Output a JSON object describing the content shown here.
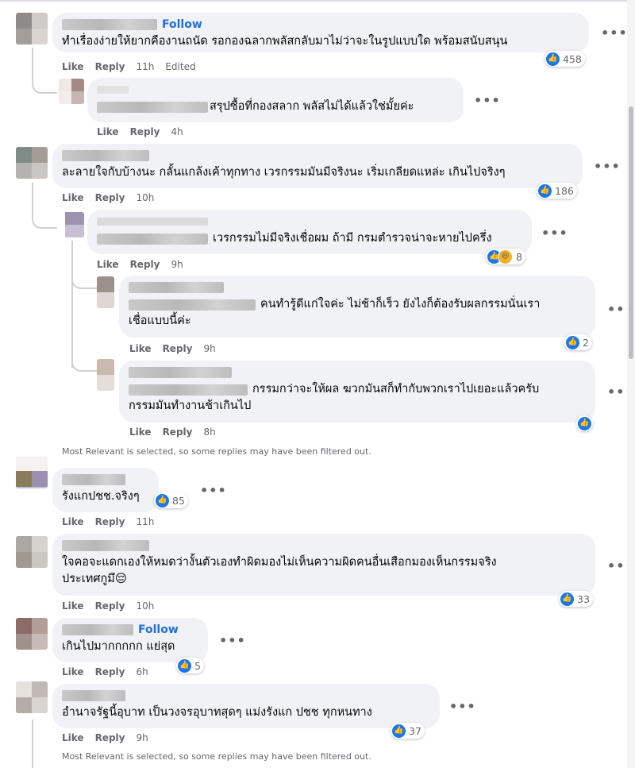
{
  "comments": [
    {
      "author_follow": "Follow",
      "text": "ทำเรื่องง่ายให้ยากคืองานถนัด รอกองฉลากพลัสกลับมาไม่ว่าจะในรูปแบบใด พร้อมสนับสนุน",
      "like": "Like",
      "reply": "Reply",
      "time": "11h",
      "edited": "Edited",
      "count": "458"
    },
    {
      "text": "สรุปซื้อที่กองสลาก พลัสไม่ได้แล้วใช่มั้ยค่ะ",
      "like": "Like",
      "reply": "Reply",
      "time": "4h"
    },
    {
      "text": "ละลายใจกับบ้างนะ กลั้นแกล้งเค้าทุกทาง เวรกรรมมันมีจริงนะ เริ่มเกลียดแหล่ะ เกินไปจริงๆ",
      "like": "Like",
      "reply": "Reply",
      "time": "10h",
      "count": "186"
    },
    {
      "text": "เวรกรรมไม่มีจริงเชื่อผม ถ้ามี กรมตำรวจน่าจะหายไปครึ่ง",
      "like": "Like",
      "reply": "Reply",
      "time": "9h",
      "count": "8"
    },
    {
      "line1": "คนทำรู้ดีแก่ใจค่ะ ไม่ช้าก็เร็ว ยังไงก็ต้องรับผลกรรมนั่นเรา",
      "line2": "เชื่อแบบนี้ค่ะ",
      "like": "Like",
      "reply": "Reply",
      "time": "9h",
      "count": "2"
    },
    {
      "line1": "กรรมกว่าจะให้ผล ฆวกมันสก็ทำกับพวกเราไปเยอะแล้วครับ",
      "line2": "กรรมมันทำงานช้าเกินไป",
      "like": "Like",
      "reply": "Reply",
      "time": "8h"
    },
    {
      "text": "รังแกปชช.จริงๆ",
      "like": "Like",
      "reply": "Reply",
      "time": "11h",
      "count": "85"
    },
    {
      "line1": "ใจคอจะแดกเองให้หมดว่างั้นตัวเองทำผิดมองไม่เห็นความผิดคนอื่นเสือกมองเห็นกรรมจริง",
      "line2": "ประเทศกูมึ😔",
      "like": "Like",
      "reply": "Reply",
      "time": "10h",
      "count": "33"
    },
    {
      "author_follow": "Follow",
      "text": "เกินไปมากกกกก แย่สุด",
      "like": "Like",
      "reply": "Reply",
      "time": "6h",
      "count": "5"
    },
    {
      "text": "อำนาจรัฐนี้อุบาท เป็นวงจรอุบาทสุดๆ แม่งรังแก ปชช ทุกหนทาง",
      "like": "Like",
      "reply": "Reply",
      "time": "9h",
      "count": "37"
    }
  ],
  "filter_note": "Most Relevant is selected, so some replies may have been filtered out.",
  "more": "•••",
  "colors": {
    "like_blue": "#1877f2",
    "follow_blue": "#216fdb",
    "bubble": "#f0f2f5",
    "meta": "#65676b"
  }
}
